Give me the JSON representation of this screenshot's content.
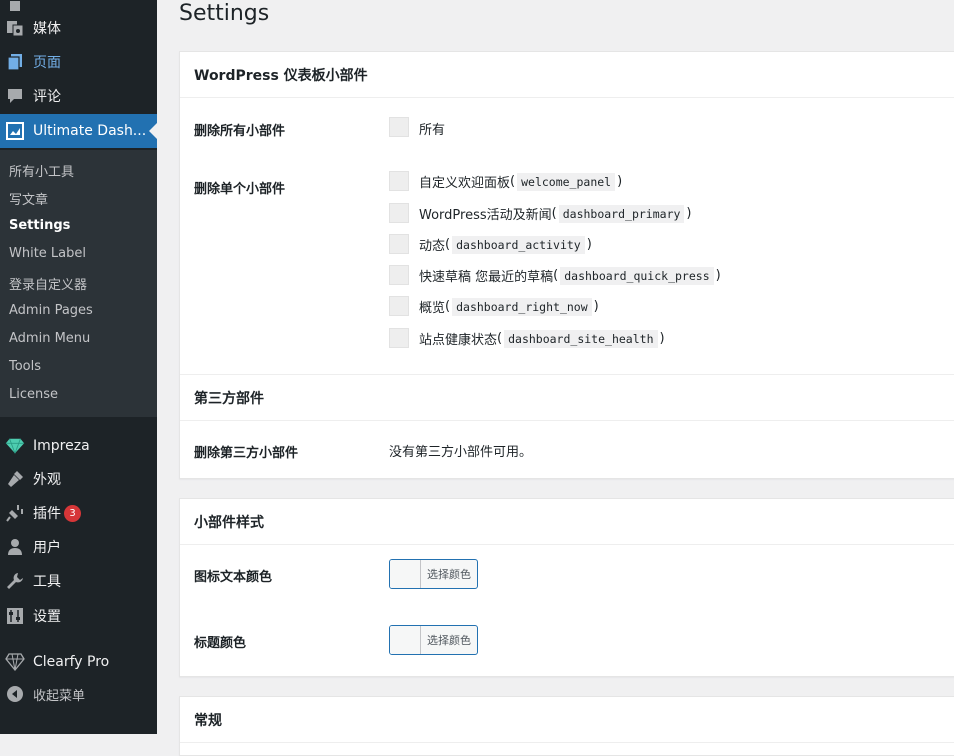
{
  "sidebar": {
    "top_items": [
      {
        "label": "媒体",
        "icon": "media-icon"
      },
      {
        "label": "页面",
        "icon": "pages-icon"
      },
      {
        "label": "评论",
        "icon": "comments-icon"
      },
      {
        "label": "Ultimate Dash...",
        "icon": "dashboard-plugin-icon"
      }
    ],
    "submenu": [
      "所有小工具",
      "写文章",
      "Settings",
      "White Label",
      "登录自定义器",
      "Admin Pages",
      "Admin Menu",
      "Tools",
      "License"
    ],
    "bottom_items": [
      {
        "label": "Impreza",
        "icon": "gem-icon"
      },
      {
        "label": "外观",
        "icon": "appearance-icon"
      },
      {
        "label": "插件",
        "icon": "plugins-icon",
        "badge": "3"
      },
      {
        "label": "用户",
        "icon": "users-icon"
      },
      {
        "label": "工具",
        "icon": "tools-icon"
      },
      {
        "label": "设置",
        "icon": "settings-icon"
      },
      {
        "label": "Clearfy Pro",
        "icon": "diamond-icon"
      },
      {
        "label": "收起菜单",
        "icon": "collapse-icon"
      }
    ]
  },
  "page": {
    "title": "Settings"
  },
  "widgets_card": {
    "title": "WordPress 仪表板小部件",
    "remove_all_label": "删除所有小部件",
    "all_option": "所有",
    "remove_single_label": "删除单个小部件",
    "widgets": [
      {
        "name": "自定义欢迎面板",
        "id": "welcome_panel"
      },
      {
        "name": "WordPress活动及新闻",
        "id": "dashboard_primary"
      },
      {
        "name": "动态",
        "id": "dashboard_activity"
      },
      {
        "name": "快速草稿 您最近的草稿",
        "id": "dashboard_quick_press"
      },
      {
        "name": "概览",
        "id": "dashboard_right_now"
      },
      {
        "name": "站点健康状态",
        "id": "dashboard_site_health"
      }
    ],
    "third_party_title": "第三方部件",
    "remove_third_party_label": "删除第三方小部件",
    "no_third_party_text": "没有第三方小部件可用。"
  },
  "style_card": {
    "title": "小部件样式",
    "icon_text_color_label": "图标文本颜色",
    "heading_color_label": "标题颜色",
    "color_button_label": "选择颜色"
  },
  "general_card": {
    "title": "常规"
  },
  "colors": {
    "sidebar_bg": "#1d2327",
    "accent": "#2271b1",
    "badge": "#d63638"
  }
}
